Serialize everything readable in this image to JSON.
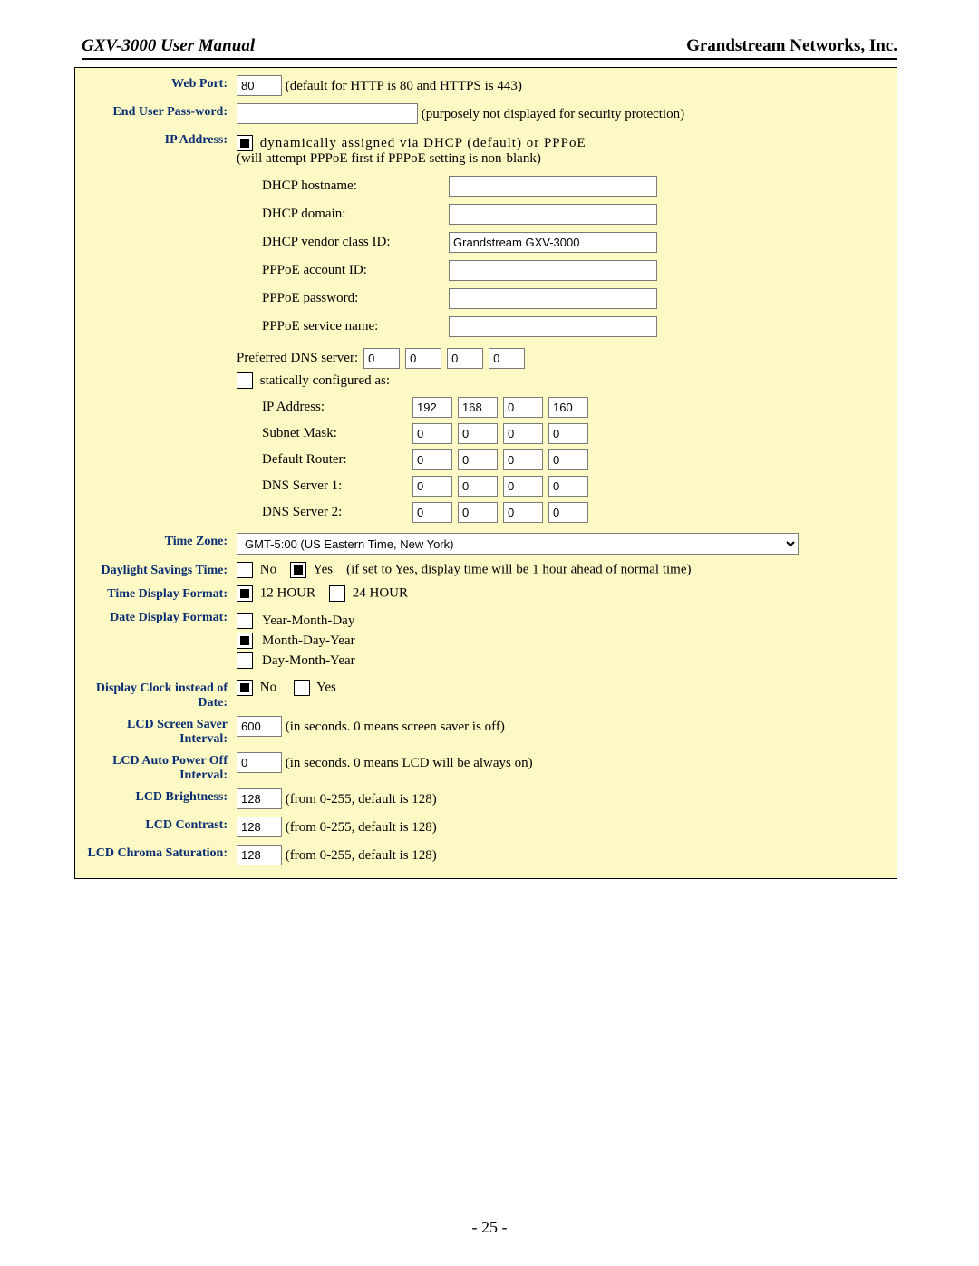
{
  "header": {
    "left": "GXV-3000 User Manual",
    "right": "Grandstream Networks, Inc."
  },
  "labels": {
    "web_port": "Web Port:",
    "end_user_pw": "End User Pass-word:",
    "ip_address": "IP Address:",
    "time_zone": "Time Zone:",
    "dst": "Daylight Savings Time:",
    "time_fmt": "Time Display Format:",
    "date_fmt": "Date Display Format:",
    "clock_date": "Display Clock instead of Date:",
    "scr_saver": "LCD Screen Saver Interval:",
    "auto_off": "LCD Auto Power Off Interval:",
    "brightness": "LCD Brightness:",
    "contrast": "LCD Contrast:",
    "chroma": "LCD Chroma Saturation:"
  },
  "web_port": {
    "value": "80",
    "hint": "(default for HTTP is 80 and HTTPS is 443)"
  },
  "end_user_pw": {
    "value": "",
    "hint": "(purposely not displayed for security protection)"
  },
  "ip": {
    "dhcp_sel": true,
    "dhcp_text": "dynamically    assigned    via    DHCP    (default)    or    PPPoE",
    "dhcp_hint": "(will attempt PPPoE first if PPPoE setting is non-blank)",
    "dhcp_hostname_lbl": "DHCP hostname:",
    "dhcp_domain_lbl": "DHCP domain:",
    "dhcp_vendor_lbl": "DHCP vendor class ID:",
    "dhcp_vendor_val": "Grandstream GXV-3000",
    "pppoe_acct_lbl": "PPPoE account ID:",
    "pppoe_pw_lbl": "PPPoE password:",
    "pppoe_svc_lbl": "PPPoE service name:",
    "pref_dns_lbl": "Preferred DNS server:",
    "pref_dns": [
      "0",
      "0",
      "0",
      "0"
    ],
    "static_sel": false,
    "static_text": "statically configured as:",
    "s_ip_lbl": "IP Address:",
    "s_ip": [
      "192",
      "168",
      "0",
      "160"
    ],
    "s_mask_lbl": "Subnet Mask:",
    "s_mask": [
      "0",
      "0",
      "0",
      "0"
    ],
    "s_router_lbl": "Default Router:",
    "s_router": [
      "0",
      "0",
      "0",
      "0"
    ],
    "s_dns1_lbl": "DNS Server 1:",
    "s_dns1": [
      "0",
      "0",
      "0",
      "0"
    ],
    "s_dns2_lbl": "DNS Server 2:",
    "s_dns2": [
      "0",
      "0",
      "0",
      "0"
    ]
  },
  "tz": {
    "value": "GMT-5:00 (US Eastern Time, New York)"
  },
  "dst": {
    "no_sel": false,
    "yes_sel": true,
    "no": "No",
    "yes": "Yes",
    "hint": "(if set to Yes, display time will be 1 hour ahead of normal time)"
  },
  "time_fmt": {
    "h12_sel": true,
    "h24_sel": false,
    "h12": "12 HOUR",
    "h24": "24 HOUR"
  },
  "date_fmt": {
    "ymd_sel": false,
    "ymd": "Year-Month-Day",
    "mdy_sel": true,
    "mdy": "Month-Day-Year",
    "dmy_sel": false,
    "dmy": "Day-Month-Year"
  },
  "clock_date": {
    "no_sel": true,
    "yes_sel": false,
    "no": "No",
    "yes": "Yes"
  },
  "scr_saver": {
    "value": "600",
    "hint": "(in seconds. 0 means screen saver is off)"
  },
  "auto_off": {
    "value": "0",
    "hint": "(in seconds. 0 means LCD will be always on)"
  },
  "brightness": {
    "value": "128",
    "hint": "(from 0-255, default is 128)"
  },
  "contrast": {
    "value": "128",
    "hint": "(from 0-255, default is 128)"
  },
  "chroma": {
    "value": "128",
    "hint": "(from 0-255, default is 128)"
  },
  "page_no": "- 25 -"
}
